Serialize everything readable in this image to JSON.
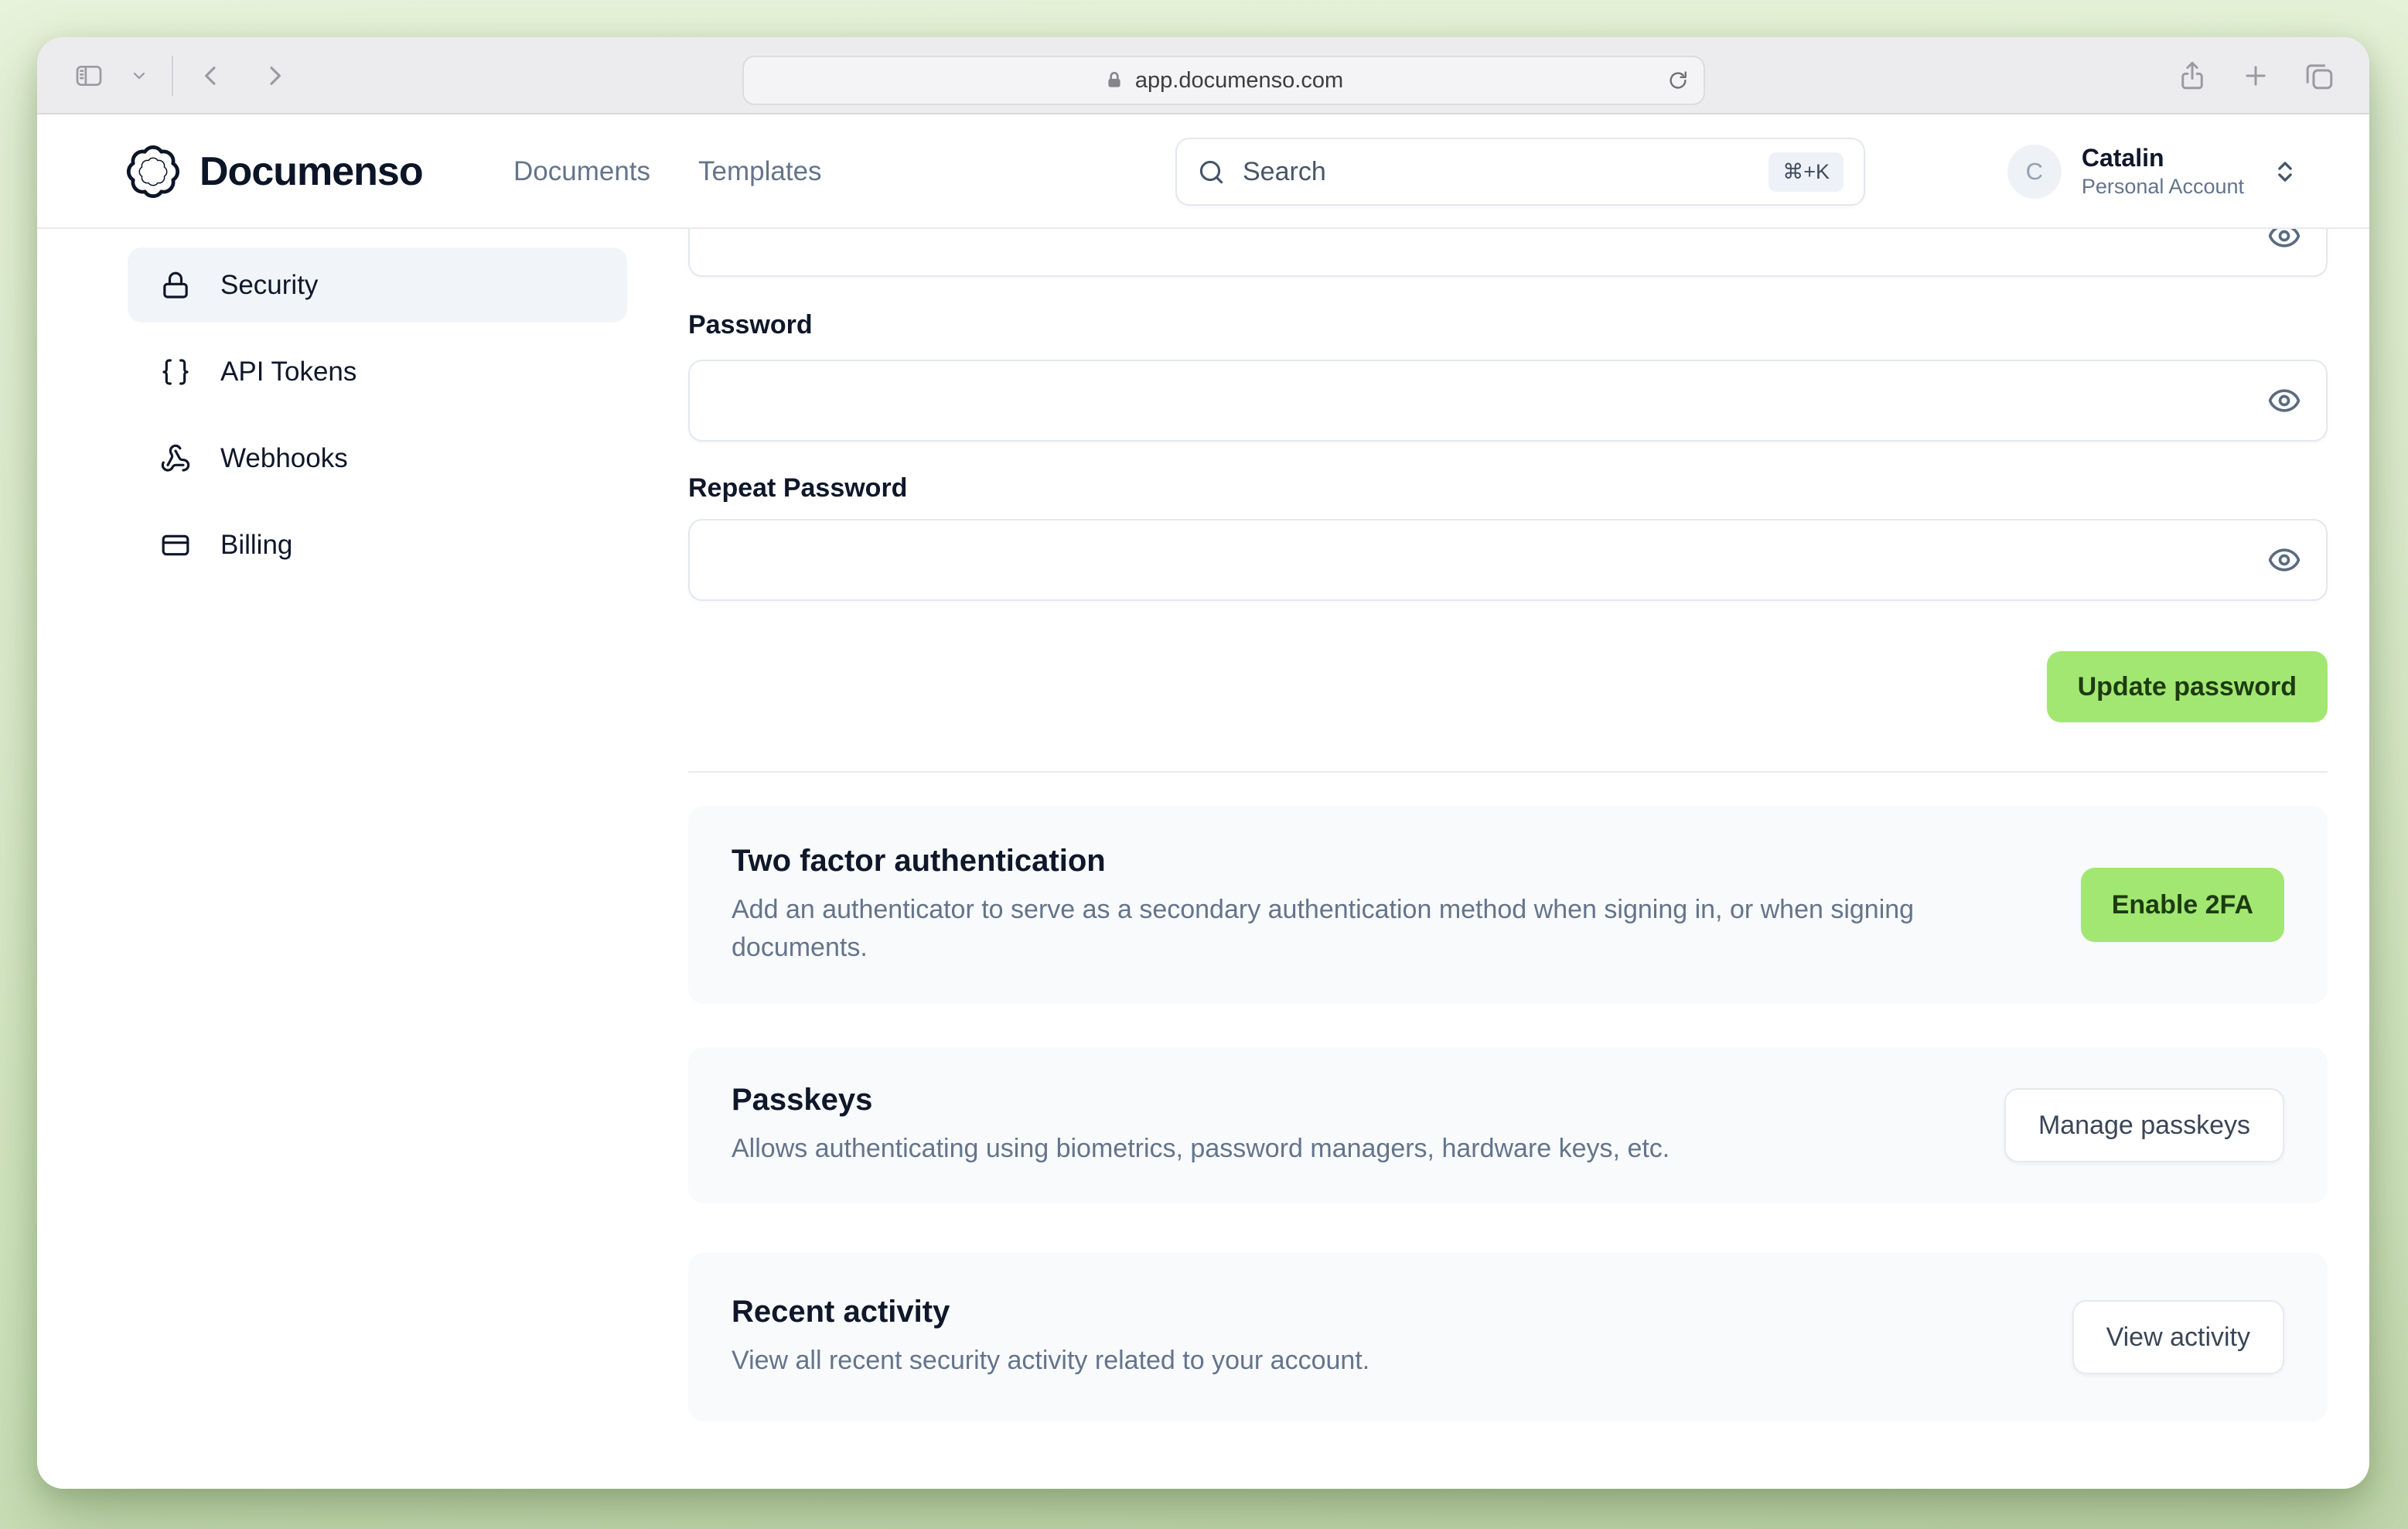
{
  "browser": {
    "url": "app.documenso.com"
  },
  "header": {
    "logo_text": "Documenso",
    "nav": [
      {
        "label": "Documents"
      },
      {
        "label": "Templates"
      }
    ],
    "search": {
      "placeholder": "Search",
      "shortcut": "⌘+K"
    },
    "account": {
      "initial": "C",
      "name": "Catalin",
      "type": "Personal Account"
    }
  },
  "sidebar": {
    "items": [
      {
        "label": "Security",
        "icon": "lock-icon",
        "active": true
      },
      {
        "label": "API Tokens",
        "icon": "braces-icon",
        "active": false
      },
      {
        "label": "Webhooks",
        "icon": "webhook-icon",
        "active": false
      },
      {
        "label": "Billing",
        "icon": "credit-card-icon",
        "active": false
      }
    ]
  },
  "form": {
    "current_password_value": "",
    "password_label": "Password",
    "password_value": "",
    "repeat_password_label": "Repeat Password",
    "repeat_password_value": "",
    "update_button": "Update password"
  },
  "sections": [
    {
      "title": "Two factor authentication",
      "description": "Add an authenticator to serve as a secondary authentication method when signing in, or when signing documents.",
      "button": "Enable 2FA",
      "button_style": "primary"
    },
    {
      "title": "Passkeys",
      "description": "Allows authenticating using biometrics, password managers, hardware keys, etc.",
      "button": "Manage passkeys",
      "button_style": "secondary"
    },
    {
      "title": "Recent activity",
      "description": "View all recent security activity related to your account.",
      "button": "View activity",
      "button_style": "secondary"
    }
  ],
  "icons": {
    "browser": [
      "sidebar-toggle-icon",
      "chevron-down-icon",
      "back-icon",
      "forward-icon",
      "padlock-icon",
      "reload-icon",
      "share-icon",
      "new-tab-icon",
      "tabs-icon"
    ],
    "app": [
      "documenso-badge-icon",
      "search-icon",
      "chevrons-up-down-icon",
      "lock-icon",
      "braces-icon",
      "webhook-icon",
      "credit-card-icon",
      "eye-icon"
    ]
  },
  "colors": {
    "accent_green": "#a2e771",
    "accent_green_text": "#1d3b12"
  }
}
